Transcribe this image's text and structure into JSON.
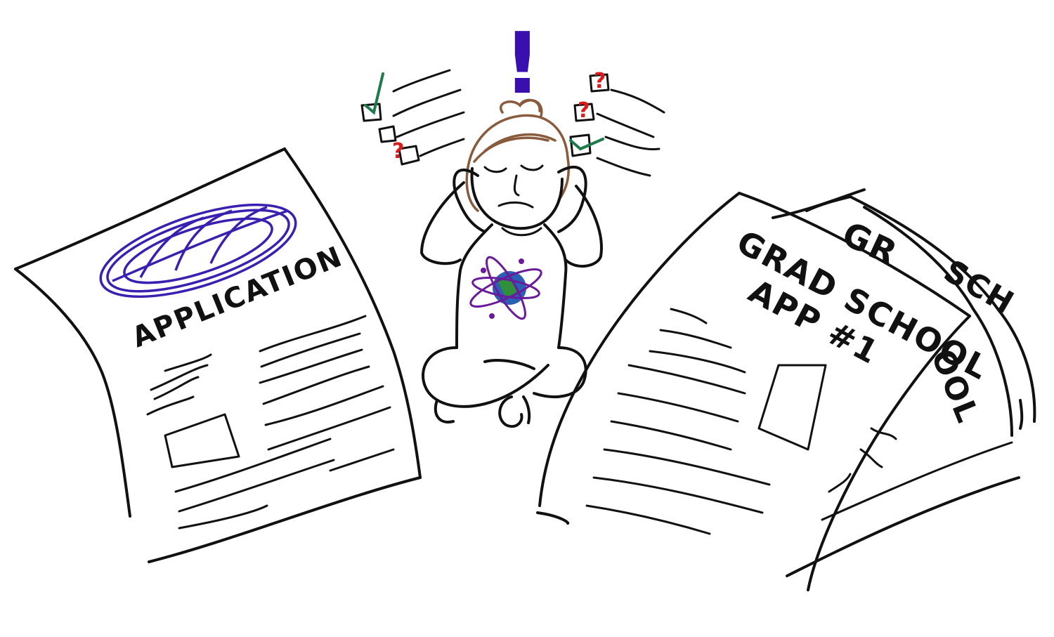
{
  "left_paper": {
    "title": "APPLICATION"
  },
  "right_paper": {
    "title_line1": "GRAD SCHOOL",
    "title_line2": "APP #1"
  },
  "back_paper": {
    "partial_text_top": "GR",
    "partial_text_mid": "SCH",
    "partial_text_side": "OOL"
  },
  "thought": {
    "exclamation": "!",
    "question": "?"
  },
  "colors": {
    "ink": "#111111",
    "logo": "#3b1fb0",
    "exclamation": "#3a0fb0",
    "check": "#1f7a4a",
    "question": "#d91c1c",
    "hair": "#8a5a3c",
    "earth_blue": "#2a5fb5",
    "earth_green": "#2f8f3a",
    "atom": "#6a1b9a"
  },
  "checklist_left": [
    {
      "state": "checked"
    },
    {
      "state": "empty"
    },
    {
      "state": "question"
    }
  ],
  "checklist_right": [
    {
      "state": "question"
    },
    {
      "state": "question"
    },
    {
      "state": "checked"
    }
  ]
}
